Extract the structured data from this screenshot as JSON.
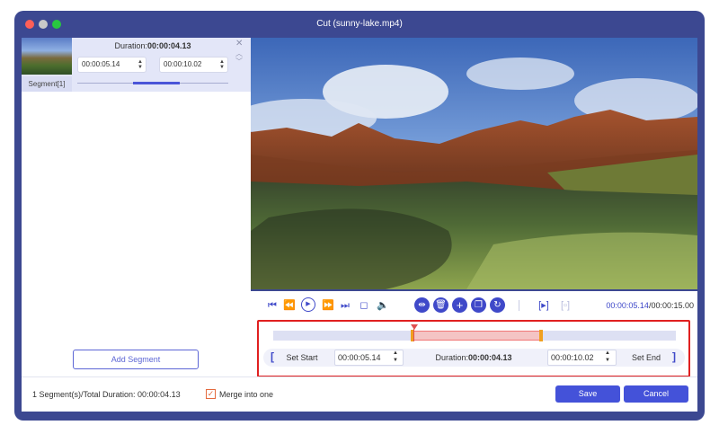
{
  "window": {
    "title": "Cut (sunny-lake.mp4)"
  },
  "segment_list": {
    "items": [
      {
        "label": "Segment[1]",
        "duration_label": "Duration:",
        "duration": "00:00:04.13",
        "start": "00:00:05.14",
        "end": "00:00:10.02"
      }
    ],
    "add_segment_label": "Add Segment"
  },
  "player": {
    "current_time": "00:00:05.14",
    "separator": "/",
    "total_time": "00:00:15.00"
  },
  "timeline": {
    "selection_start_fraction": 0.3427,
    "selection_end_fraction": 0.668,
    "playhead_fraction": 0.3427,
    "set_start_label": "Set Start",
    "set_end_label": "Set End",
    "start_value": "00:00:05.14",
    "end_value": "00:00:10.02",
    "duration_label": "Duration:",
    "duration_value": "00:00:04.13"
  },
  "footer": {
    "summary": "1 Segment(s)/Total Duration: 00:00:04.13",
    "merge_label": "Merge into one",
    "merge_checked": true,
    "save_label": "Save",
    "cancel_label": "Cancel"
  },
  "icons": {
    "controls": [
      "skip-to-start-icon",
      "step-back-icon",
      "play-icon",
      "step-forward-icon",
      "skip-to-end-icon",
      "stop-icon",
      "volume-icon",
      "split-icon",
      "delete-icon",
      "add-icon",
      "copy-icon",
      "reset-icon",
      "mark-in-icon",
      "mark-out-icon"
    ]
  },
  "colors": {
    "accent": "#3f49c9",
    "frame": "#3c4891",
    "highlight": "#e02020"
  }
}
